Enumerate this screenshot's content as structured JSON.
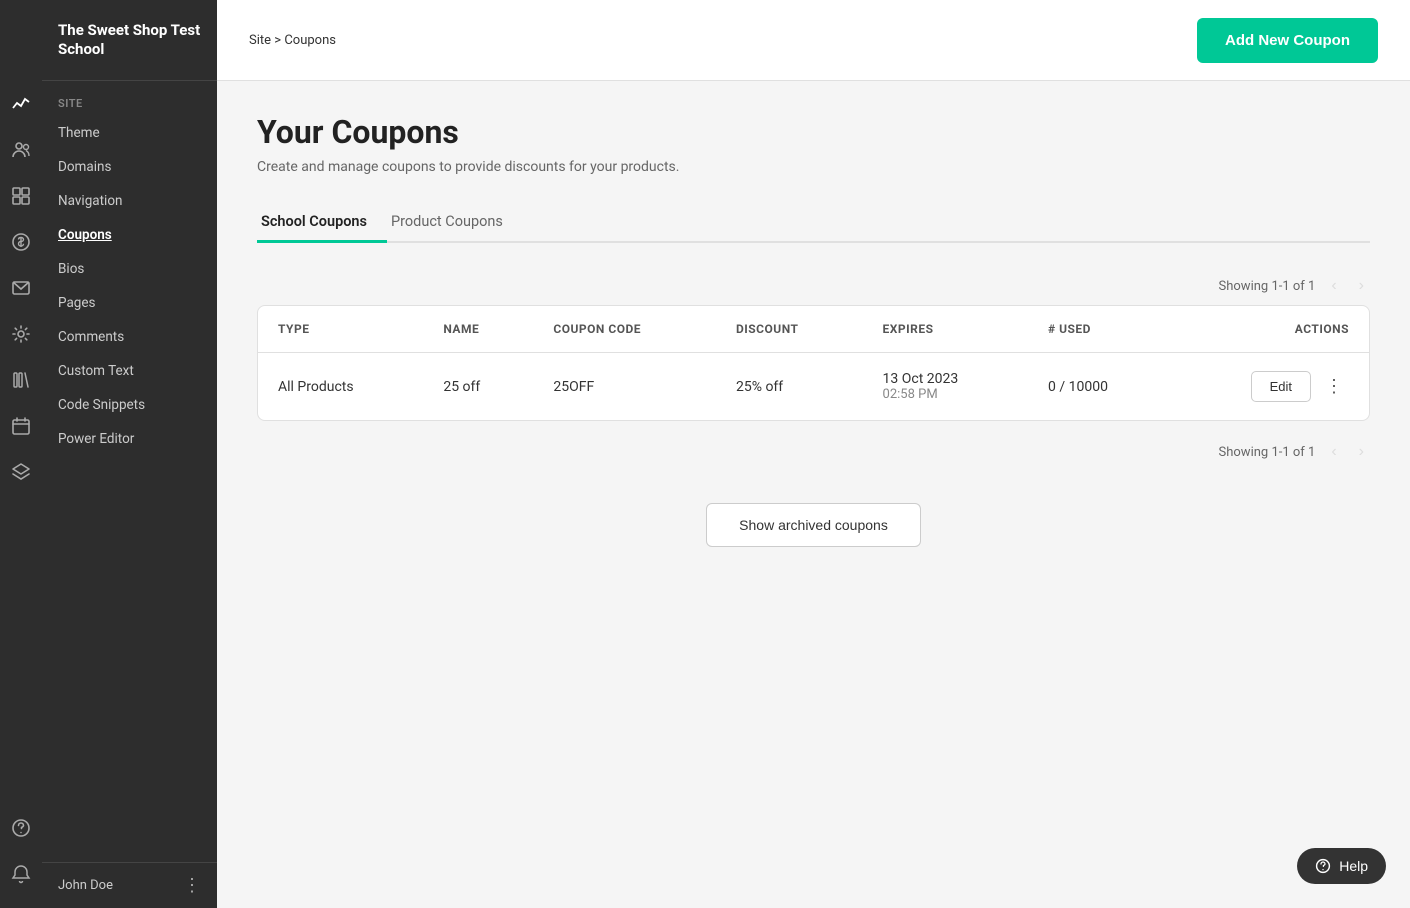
{
  "app": {
    "school_name": "The Sweet Shop Test School"
  },
  "breadcrumb": {
    "site": "Site",
    "separator": ">",
    "current": "Coupons"
  },
  "header": {
    "add_coupon_label": "Add New Coupon"
  },
  "page": {
    "title": "Your Coupons",
    "subtitle": "Create and manage coupons to provide discounts for your products."
  },
  "tabs": [
    {
      "id": "school",
      "label": "School Coupons",
      "active": true
    },
    {
      "id": "product",
      "label": "Product Coupons",
      "active": false
    }
  ],
  "pagination": {
    "top": "Showing 1-1 of 1",
    "bottom": "Showing 1-1 of 1"
  },
  "table": {
    "columns": [
      {
        "id": "type",
        "label": "TYPE"
      },
      {
        "id": "name",
        "label": "NAME"
      },
      {
        "id": "code",
        "label": "COUPON CODE"
      },
      {
        "id": "discount",
        "label": "DISCOUNT"
      },
      {
        "id": "expires",
        "label": "EXPIRES"
      },
      {
        "id": "used",
        "label": "# USED"
      },
      {
        "id": "actions",
        "label": "ACTIONS"
      }
    ],
    "rows": [
      {
        "type": "All Products",
        "name": "25 off",
        "code": "25OFF",
        "discount": "25% off",
        "expires_date": "13 Oct 2023",
        "expires_time": "02:58 PM",
        "used": "0 / 10000",
        "edit_label": "Edit"
      }
    ]
  },
  "sidebar": {
    "section_label": "SITE",
    "items": [
      {
        "id": "theme",
        "label": "Theme"
      },
      {
        "id": "domains",
        "label": "Domains"
      },
      {
        "id": "navigation",
        "label": "Navigation"
      },
      {
        "id": "coupons",
        "label": "Coupons",
        "active": true
      },
      {
        "id": "bios",
        "label": "Bios"
      },
      {
        "id": "pages",
        "label": "Pages"
      },
      {
        "id": "comments",
        "label": "Comments"
      },
      {
        "id": "custom-text",
        "label": "Custom Text"
      },
      {
        "id": "code-snippets",
        "label": "Code Snippets"
      },
      {
        "id": "power-editor",
        "label": "Power Editor"
      }
    ],
    "user": {
      "name": "John Doe"
    }
  },
  "archived": {
    "button_label": "Show archived coupons"
  },
  "help": {
    "label": "Help"
  }
}
